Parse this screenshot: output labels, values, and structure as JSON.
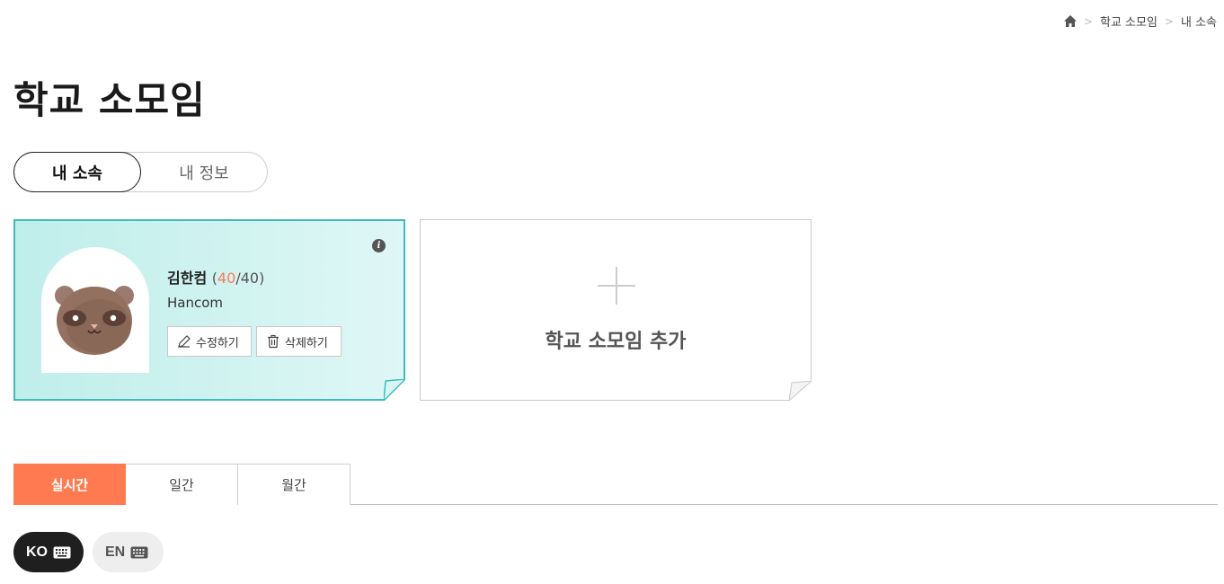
{
  "breadcrumb": {
    "items": [
      "학교 소모임",
      "내 소속"
    ]
  },
  "page_title": "학교 소모임",
  "segmented": {
    "active": "내 소속",
    "inactive": "내 정보"
  },
  "group_card": {
    "name": "김한컴",
    "count_open": "(",
    "count_current": "40",
    "count_total": "/40)",
    "org": "Hancom",
    "edit_label": "수정하기",
    "delete_label": "삭제하기",
    "info_glyph": "i"
  },
  "add_card": {
    "label": "학교 소모임 추가"
  },
  "period_tabs": [
    "실시간",
    "일간",
    "월간"
  ],
  "language": {
    "ko": "KO",
    "en": "EN"
  },
  "colors": {
    "accent": "#ff7a50",
    "card_border": "#3dbdb9",
    "card_bg": "#c8f0ee"
  },
  "icons": [
    "home-icon",
    "chevron-right-icon",
    "info-icon",
    "pencil-icon",
    "trash-icon",
    "plus-icon",
    "keyboard-icon",
    "raccoon-avatar"
  ]
}
